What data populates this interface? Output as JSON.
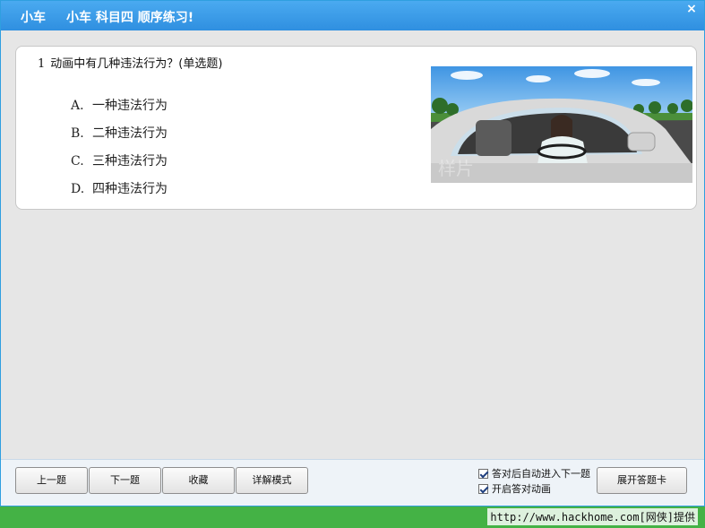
{
  "window": {
    "title_left": "小车",
    "title_main": "小车  科目四  顺序练习!",
    "close_glyph": "×"
  },
  "question": {
    "number": "1",
    "text": "动画中有几种违法行为？(单选题)",
    "options": [
      {
        "letter": "A.",
        "text": "一种违法行为"
      },
      {
        "letter": "B.",
        "text": "二种违法行为"
      },
      {
        "letter": "C.",
        "text": "三种违法行为"
      },
      {
        "letter": "D.",
        "text": "四种违法行为"
      }
    ],
    "image_watermark": "样片"
  },
  "toolbar": {
    "prev_label": "上一题",
    "next_label": "下一题",
    "favorite_label": "收藏",
    "detail_label": "详解模式",
    "auto_next_label": "答对后自动进入下一题",
    "auto_next_checked": true,
    "animation_label": "开启答对动画",
    "animation_checked": true,
    "answer_card_label": "展开答题卡"
  },
  "footer": {
    "source_text": "http://www.hackhome.com[网侠]提供"
  },
  "colors": {
    "title_bar": "#3a9ee8",
    "status_bar": "#44b245",
    "background": "#e6e6e6"
  }
}
